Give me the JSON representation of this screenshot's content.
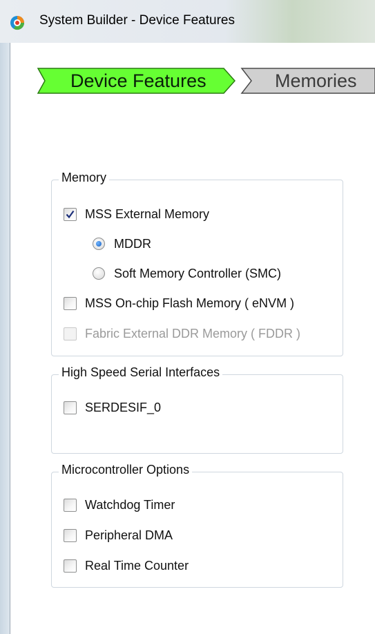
{
  "window": {
    "title": "System Builder - Device Features"
  },
  "wizard": {
    "steps": [
      {
        "label": "Device Features",
        "state": "active"
      },
      {
        "label": "Memories",
        "state": "inactive"
      }
    ],
    "colors": {
      "active": "#66ff33",
      "inactive": "#d0d0d0"
    }
  },
  "memory": {
    "title": "Memory",
    "mss_external": {
      "label": "MSS External Memory",
      "checked": true
    },
    "mddr": {
      "label": "MDDR",
      "selected": true
    },
    "smc": {
      "label": "Soft Memory Controller (SMC)",
      "selected": false
    },
    "envm": {
      "label": "MSS On-chip Flash Memory ( eNVM )",
      "checked": false
    },
    "fddr": {
      "label": "Fabric External DDR Memory ( FDDR )",
      "checked": false,
      "enabled": false
    }
  },
  "serdes": {
    "title": "High Speed Serial Interfaces",
    "serdesif_0": {
      "label": "SERDESIF_0",
      "checked": false
    }
  },
  "micro": {
    "title": "Microcontroller Options",
    "watchdog": {
      "label": "Watchdog Timer",
      "checked": false
    },
    "pdma": {
      "label": "Peripheral DMA",
      "checked": false
    },
    "rtc": {
      "label": "Real Time Counter",
      "checked": false
    }
  }
}
